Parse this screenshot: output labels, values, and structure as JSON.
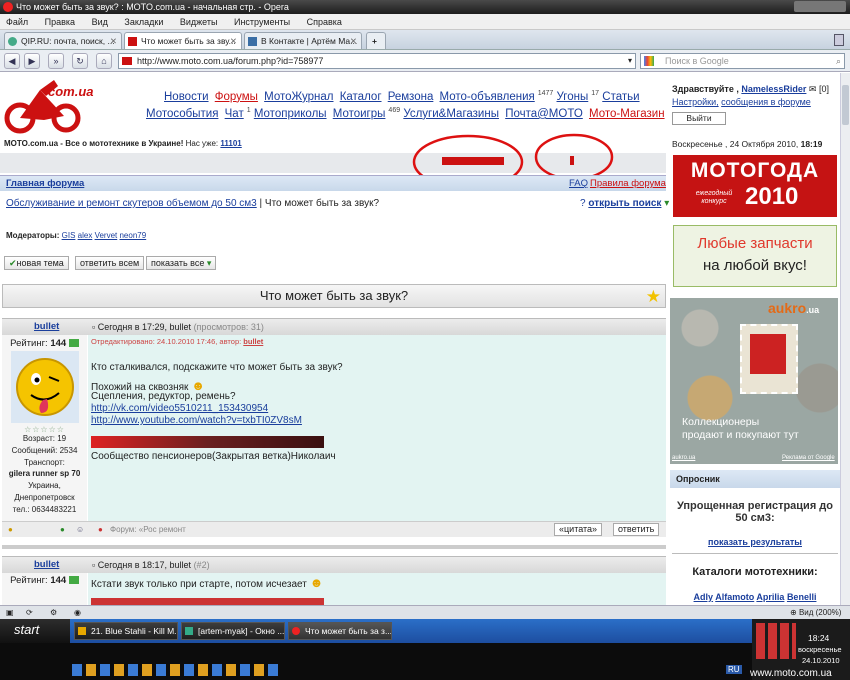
{
  "window": {
    "title": "Что может быть за звук? : MOTO.com.ua - начальная стр. - Opera"
  },
  "menu": [
    "Файл",
    "Правка",
    "Вид",
    "Закладки",
    "Виджеты",
    "Инструменты",
    "Справка"
  ],
  "tabs": [
    {
      "label": "QIP.RU: почта, поиск, ..."
    },
    {
      "label": "Что может быть за зву..."
    },
    {
      "label": "В Контакте | Артём Ма..."
    }
  ],
  "address": {
    "url": "http://www.moto.com.ua/forum.php?id=758977",
    "search_placeholder": "Поиск в Google"
  },
  "logo": {
    "text": "com.ua"
  },
  "nav": {
    "row1": [
      {
        "label": "Новости"
      },
      {
        "label": "Форумы"
      },
      {
        "label": "МотоЖурнал"
      },
      {
        "label": "Каталог"
      },
      {
        "label": "Ремзона"
      },
      {
        "label": "Мото-объявления",
        "sup": "1477"
      },
      {
        "label": "Угоны",
        "sup": "17"
      },
      {
        "label": "Статьи"
      }
    ],
    "row2": [
      {
        "label": "Мотособытия"
      },
      {
        "label": "Чат",
        "sup": "1"
      },
      {
        "label": "Мотоприколы"
      },
      {
        "label": "Мотоигры",
        "sup": "469"
      },
      {
        "label": "Услуги&Магазины"
      },
      {
        "label": "Почта@МОТО"
      },
      {
        "label": "Мото-Магазин"
      }
    ]
  },
  "tagline": {
    "text": "MOTO.com.ua - Все о мототехнике в Украине!",
    "online_label": "Нас уже:",
    "online_count": "11101"
  },
  "user": {
    "greeting": "Здравствуйте ,",
    "name": "NamelessRider",
    "messages": "[0]",
    "settings": "Настройки,",
    "forum_messages": "сообщения в форуме",
    "logout": "Выйти",
    "date": "Воскресенье , 24 Октября 2010,",
    "time": "18:19"
  },
  "forum": {
    "home": "Главная форума",
    "faq": "FAQ",
    "rules": "Правила форума",
    "section": "Обслуживание и ремонт скутеров объемом до 50 см3",
    "separator": "|",
    "current": "Что может быть за звук?",
    "search_toggle": "открыть поиск",
    "moderators_label": "Модераторы:",
    "moderators": [
      "GIS",
      "alex",
      "Vervet",
      "neon79"
    ],
    "actions": {
      "new_topic": "новая тема",
      "reply_all": "ответить всем",
      "show_all": "показать все"
    },
    "thread_title": "Что может быть за звук?"
  },
  "posts": [
    {
      "author": "bullet",
      "header": "Сегодня в 17:29, bullet",
      "views": "(просмотров: 31)",
      "rating_label": "Рейтинг:",
      "rating": "144",
      "edited": "Отредактировано: 24.10.2010 17:46, автор:",
      "edited_by": "bullet",
      "lines": [
        "Кто сталкивался, подскажите что может быть за звук?",
        "Похожий на сквозняк",
        "Сцепления, редуктор, ремень?"
      ],
      "links": [
        "http://vk.com/video5510211_153430954",
        "http://www.youtube.com/watch?v=txbTI0ZV8sM"
      ],
      "signature": "Сообщество пенсионеров(Закрытая ветка)Николаич",
      "profile": {
        "age_label": "Возраст:",
        "age": "19",
        "posts_label": "Сообщений:",
        "posts": "2534",
        "transport_label": "Транспорт:",
        "transport": "gilera runner sp 70",
        "country": "Украина,",
        "city": "Днепропетровск",
        "phone": "тел.: 0634483221"
      },
      "footer": {
        "forum": "Форум: «Рос ремонт",
        "quote": "«цитата»",
        "reply": "ответить"
      }
    },
    {
      "author": "bullet",
      "header": "Сегодня в 18:17, bullet",
      "number": "(#2)",
      "rating_label": "Рейтинг:",
      "rating": "144",
      "lines": [
        "Кстати звук только при старте, потом исчезает"
      ]
    }
  ],
  "ads": {
    "motogoda": {
      "line1": "МОТОГОДА",
      "line2": "ежегодный конкурс",
      "year": "2010"
    },
    "zapchasti": {
      "line1": "Любые запчасти",
      "line2": "на любой вкус!"
    },
    "aukro": {
      "brand": "aukro",
      "brand_suffix": ".ua",
      "text1": "Коллекционеры",
      "text2": "продают и покупают тут",
      "source": "aukro.ua",
      "google": "Реклама от Google"
    }
  },
  "poll": {
    "title": "Опросник",
    "question": "Упрощенная регистрация до 50 см3:",
    "results": "показать результаты"
  },
  "catalog": {
    "title": "Каталоги мототехники:",
    "brands": [
      "Adly",
      "Alfamoto",
      "Aprilia",
      "Benelli"
    ]
  },
  "status": {
    "zoom": "Вид (200%)"
  },
  "taskbar": {
    "start": "start",
    "items": [
      "21. Blue Stahli - Kill M...",
      "[artem-myak] - Окно ...",
      "Что может быть за з..."
    ],
    "clock": "18:24",
    "day": "воскресенье",
    "date": "24.10.2010",
    "lang": "RU"
  },
  "watermark": "www.moto.com.ua",
  "colors": {
    "brand_red": "#cc1111",
    "link": "#1a3e9c",
    "post_bg": "#e3f4f2"
  }
}
